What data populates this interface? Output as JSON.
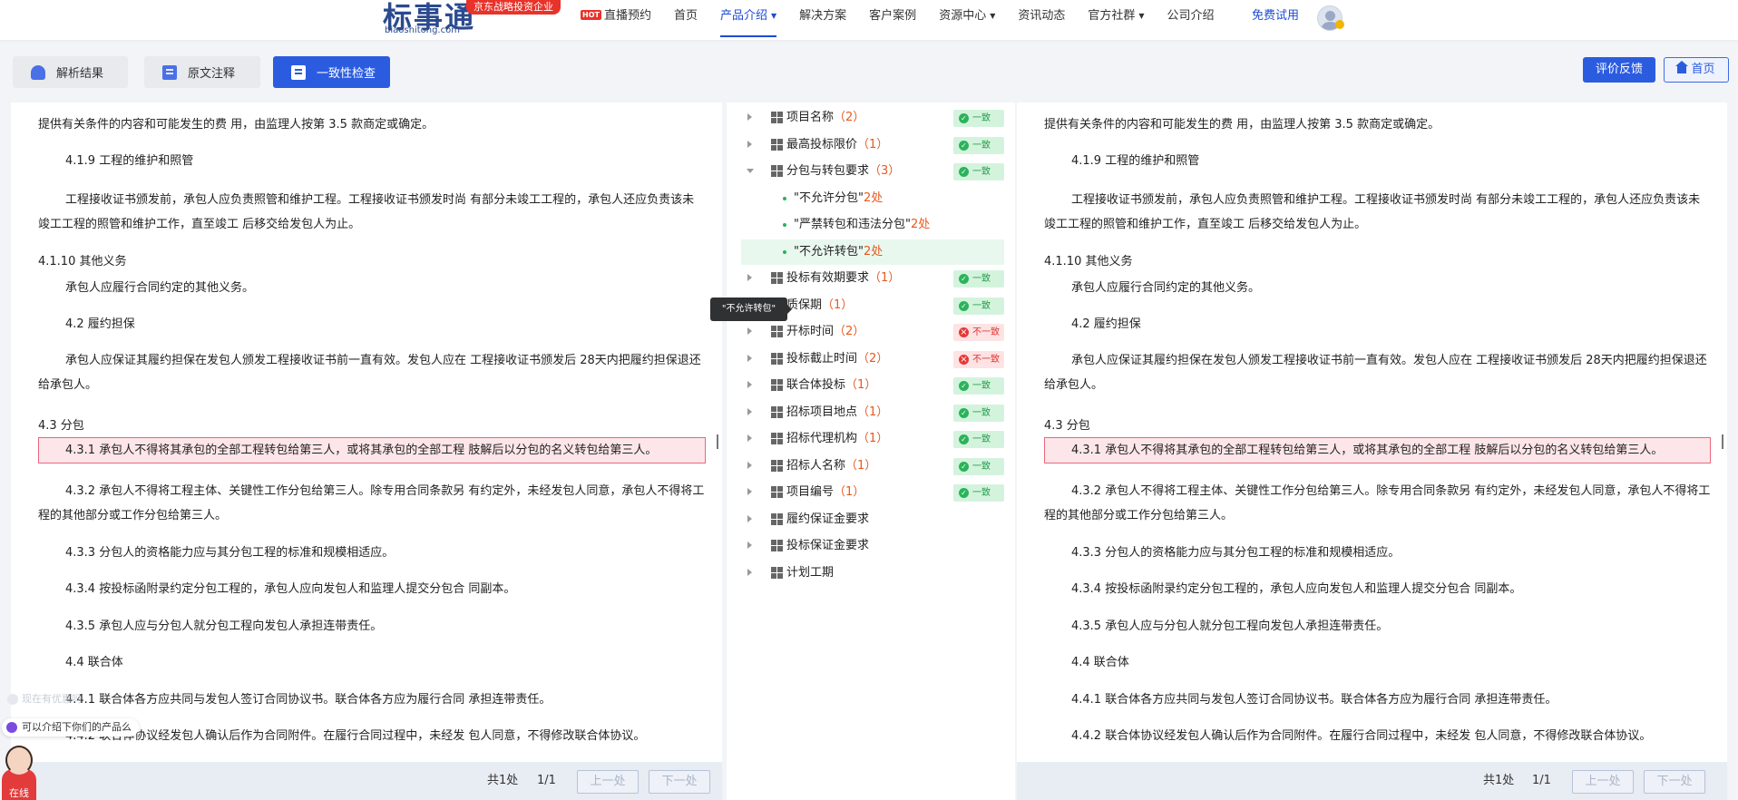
{
  "brand": {
    "logo_text": "标事通",
    "domain": "biaoshitong.com",
    "badge": "京东战略投资企业"
  },
  "nav": {
    "hot_badge": "HOT",
    "items": [
      {
        "label": "直播预约"
      },
      {
        "label": "首页"
      },
      {
        "label": "产品介绍",
        "caret": "▼"
      },
      {
        "label": "解决方案"
      },
      {
        "label": "客户案例"
      },
      {
        "label": "资源中心",
        "caret": "▼"
      },
      {
        "label": "资讯动态"
      },
      {
        "label": "官方社群",
        "caret": "▼"
      },
      {
        "label": "公司介绍"
      }
    ],
    "active_index": 2,
    "free_trial": "免费试用"
  },
  "tabs": [
    {
      "label": "解析结果",
      "icon": "parse-result-icon"
    },
    {
      "label": "原文注释",
      "icon": "annotation-icon"
    },
    {
      "label": "一致性检查",
      "icon": "consistency-check-icon"
    }
  ],
  "active_tab": 2,
  "actions": {
    "feedback": "评价反馈",
    "home": "首页"
  },
  "document": {
    "lines": [
      "提供有关条件的内容和可能发生的费 用，由监理人按第 3.5 款商定或确定。",
      "4.1.9 工程的维护和照管",
      "工程接收证书颁发前，承包人应负责照管和维护工程。工程接收证书颁发时尚   有部分未竣工工程的，承包人还应负责该未",
      "竣工工程的照管和维护工作，直至竣工 后移交给发包人为止。",
      "4.1.10 其他义务",
      "承包人应履行合同约定的其他义务。",
      "4.2 履约担保",
      "承包人应保证其履约担保在发包人颁发工程接收证书前一直有效。发包人应在 工程接收证书颁发后 28天内把履约担保退还",
      "给承包人。",
      "4.3 分包",
      "4.3.1 承包人不得将其承包的全部工程转包给第三人，或将其承包的全部工程 肢解后以分包的名义转包给第三人。",
      "4.3.2 承包人不得将工程主体、关键性工作分包给第三人。除专用合同条款另 有约定外，未经发包人同意，承包人不得将工",
      "程的其他部分或工作分包给第三人。",
      "4.3.3 分包人的资格能力应与其分包工程的标准和规模相适应。",
      "4.3.4 按投标函附录约定分包工程的，承包人应向发包人和监理人提交分包合 同副本。",
      "4.3.5 承包人应与分包人就分包工程向发包人承担连带责任。",
      "4.4 联合体",
      "4.4.1 联合体各方应共同与发包人签订合同协议书。联合体各方应为履行合同 承担连带责任。",
      "4.4.2 联合体协议经发包人确认后作为合同附件。在履行合同过程中，未经发 包人同意，不得修改联合体协议。"
    ],
    "highlighted_index": 10,
    "footer": {
      "total_prefix": "共",
      "total": "1",
      "total_suffix": "处",
      "page": "1/1",
      "prev": "上一处",
      "next": "下一处"
    }
  },
  "tree": {
    "ok_label": "一致",
    "bad_label": "不一致",
    "items": [
      {
        "label": "项目名称",
        "count": "（2）",
        "status": "ok"
      },
      {
        "label": "最高投标限价",
        "count": "（1）",
        "status": "ok"
      },
      {
        "label": "分包与转包要求",
        "count": "（3）",
        "status": "ok",
        "expanded": true,
        "children": [
          {
            "label": "\"不允许分包\"",
            "count": "2处"
          },
          {
            "label": "\"严禁转包和违法分包\"",
            "count": "2处"
          },
          {
            "label": "\"不允许转包\"",
            "count": "2处",
            "selected": true
          }
        ]
      },
      {
        "label": "投标有效期要求",
        "count": "（1）",
        "status": "ok"
      },
      {
        "label": "质保期",
        "count": "（1）",
        "status": "ok"
      },
      {
        "label": "开标时间",
        "count": "（2）",
        "status": "bad"
      },
      {
        "label": "投标截止时间",
        "count": "（2）",
        "status": "bad"
      },
      {
        "label": "联合体投标",
        "count": "（1）",
        "status": "ok"
      },
      {
        "label": "招标项目地点",
        "count": "（1）",
        "status": "ok"
      },
      {
        "label": "招标代理机构",
        "count": "（1）",
        "status": "ok"
      },
      {
        "label": "招标人名称",
        "count": "（1）",
        "status": "ok"
      },
      {
        "label": "项目编号",
        "count": "（1）",
        "status": "ok"
      },
      {
        "label": "履约保证金要求",
        "count": "",
        "status": ""
      },
      {
        "label": "投标保证金要求",
        "count": "",
        "status": ""
      },
      {
        "label": "计划工期",
        "count": "",
        "status": ""
      }
    ]
  },
  "tooltip": "\"不允许转包\"",
  "chat": {
    "ghost_text": "现在有优惠吗",
    "message": "可以介绍下你们的产品么",
    "agent_status": "在线"
  },
  "colors": {
    "accent": "#2b5ce0",
    "ok": "#2bb35a",
    "bad": "#e53935",
    "count": "#e8591e"
  }
}
